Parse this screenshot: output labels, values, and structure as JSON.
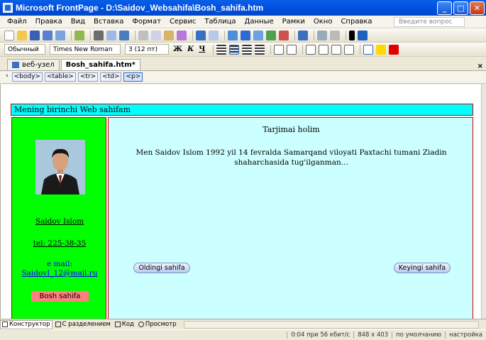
{
  "window": {
    "title": "Microsoft FrontPage - D:\\Saidov_Websahifa\\Bosh_sahifa.htm"
  },
  "menu": {
    "items": [
      "Файл",
      "Правка",
      "Вид",
      "Вставка",
      "Формат",
      "Сервис",
      "Таблица",
      "Данные",
      "Рамки",
      "Окно",
      "Справка"
    ],
    "help_placeholder": "Введите вопрос"
  },
  "format_toolbar": {
    "style": "Обычный",
    "font": "Times New Roman",
    "size": "3 (12 пт)",
    "bold": "Ж",
    "italic": "К",
    "underline": "Ч"
  },
  "doc_tabs": {
    "site": "веб-узел",
    "file": "Bosh_sahifa.htm*"
  },
  "tag_selector": [
    "<body>",
    "<table>",
    "<tr>",
    "<td>",
    "<p>"
  ],
  "page": {
    "header": "Mening birinchi Web sahifam",
    "name": "Saidov Islom",
    "phone": "tel: 225-38-35",
    "email_label": "e mail:",
    "email": "SaidovI_12@mail.ru",
    "home_button": "Bosh sahifa",
    "main_title": "Tarjimai holim",
    "main_text": "Men Saidov Islom 1992 yil 14 fevralda Samarqand viloyati Paxtachi tumani Ziadin shaharchasida tug'ilganman...",
    "prev_button": "Oldingi sahifa",
    "next_button": "Keyingi sahifa",
    "colors": {
      "header_bg": "#00ffff",
      "left_bg": "#00ff00",
      "main_bg": "#ccffff",
      "home_btn_bg": "#ff7f7f"
    }
  },
  "view_tabs": {
    "design": "Конструктор",
    "split": "С разделением",
    "code": "Код",
    "preview": "Просмотр"
  },
  "status": {
    "speed": "0:04 при 56 кбит/с",
    "dimensions": "848 x 403",
    "default": "по умолчанию",
    "settings": "настройка"
  }
}
